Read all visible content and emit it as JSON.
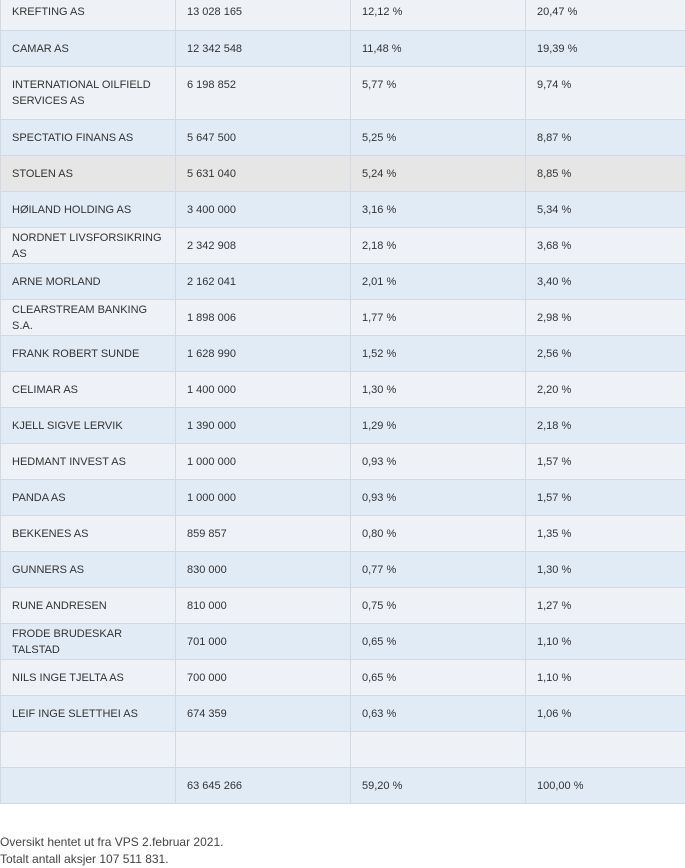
{
  "rows": [
    {
      "name": "KREFTING AS",
      "shares": "13 028 165",
      "pct_total": "12,12 %",
      "pct_other": "20,47 %"
    },
    {
      "name": "CAMAR AS",
      "shares": "12 342 548",
      "pct_total": "11,48 %",
      "pct_other": "19,39 %"
    },
    {
      "name": "INTERNATIONAL OILFIELD SERVICES AS",
      "shares": "6 198 852",
      "pct_total": "5,77 %",
      "pct_other": "9,74 %"
    },
    {
      "name": "SPECTATIO FINANS AS",
      "shares": "5 647 500",
      "pct_total": "5,25 %",
      "pct_other": "8,87 %"
    },
    {
      "name": "STOLEN AS",
      "shares": "5 631 040",
      "pct_total": "5,24 %",
      "pct_other": "8,85 %"
    },
    {
      "name": "HØILAND HOLDING AS",
      "shares": "3 400 000",
      "pct_total": "3,16 %",
      "pct_other": "5,34 %"
    },
    {
      "name": "NORDNET LIVSFORSIKRING AS",
      "shares": "2 342 908",
      "pct_total": "2,18 %",
      "pct_other": "3,68 %"
    },
    {
      "name": "ARNE MORLAND",
      "shares": "2 162 041",
      "pct_total": "2,01 %",
      "pct_other": "3,40 %"
    },
    {
      "name": "CLEARSTREAM BANKING S.A.",
      "shares": "1 898 006",
      "pct_total": "1,77 %",
      "pct_other": "2,98 %"
    },
    {
      "name": "FRANK ROBERT SUNDE",
      "shares": "1 628 990",
      "pct_total": "1,52 %",
      "pct_other": "2,56 %"
    },
    {
      "name": "CELIMAR AS",
      "shares": "1 400 000",
      "pct_total": "1,30 %",
      "pct_other": "2,20 %"
    },
    {
      "name": "KJELL SIGVE LERVIK",
      "shares": "1 390 000",
      "pct_total": "1,29 %",
      "pct_other": "2,18 %"
    },
    {
      "name": "HEDMANT INVEST AS",
      "shares": "1 000 000",
      "pct_total": "0,93 %",
      "pct_other": "1,57 %"
    },
    {
      "name": "PANDA AS",
      "shares": "1 000 000",
      "pct_total": "0,93 %",
      "pct_other": "1,57 %"
    },
    {
      "name": "BEKKENES AS",
      "shares": "859 857",
      "pct_total": "0,80 %",
      "pct_other": "1,35 %"
    },
    {
      "name": "GUNNERS AS",
      "shares": "830 000",
      "pct_total": "0,77 %",
      "pct_other": "1,30 %"
    },
    {
      "name": "RUNE ANDRESEN",
      "shares": "810 000",
      "pct_total": "0,75 %",
      "pct_other": "1,27 %"
    },
    {
      "name": "FRODE BRUDESKAR TALSTAD",
      "shares": "701 000",
      "pct_total": "0,65 %",
      "pct_other": "1,10 %"
    },
    {
      "name": "NILS INGE TJELTA AS",
      "shares": "700 000",
      "pct_total": "0,65 %",
      "pct_other": "1,10 %"
    },
    {
      "name": "LEIF INGE SLETTHEI AS",
      "shares": "674 359",
      "pct_total": "0,63 %",
      "pct_other": "1,06 %"
    },
    {
      "name": "",
      "shares": "",
      "pct_total": "",
      "pct_other": ""
    },
    {
      "name": "",
      "shares": "63 645 266",
      "pct_total": "59,20 %",
      "pct_other": "100,00 %"
    }
  ],
  "footer": {
    "source": "Oversikt hentet ut fra VPS 2.februar 2021.",
    "total": "Totalt antall aksjer 107 511 831."
  }
}
